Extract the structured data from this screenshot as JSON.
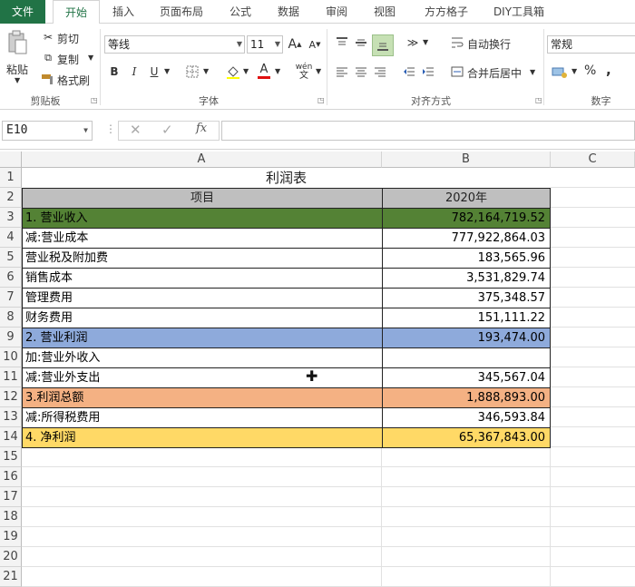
{
  "ribbon": {
    "tabs": [
      "文件",
      "开始",
      "插入",
      "页面布局",
      "公式",
      "数据",
      "审阅",
      "视图",
      "方方格子",
      "DIY工具箱"
    ],
    "active_tab": "开始",
    "clipboard": {
      "paste": "粘贴",
      "cut": "剪切",
      "copy": "复制",
      "format_painter": "格式刷",
      "group": "剪贴板"
    },
    "font": {
      "name": "等线",
      "size": "11",
      "group": "字体"
    },
    "alignment": {
      "wrap": "自动换行",
      "merge": "合并后居中",
      "group": "对齐方式"
    },
    "number": {
      "format": "常规",
      "percent": "%",
      "comma": ",",
      "group": "数字"
    }
  },
  "formula_bar": {
    "name_box": "E10",
    "fx": "fx",
    "value": ""
  },
  "grid": {
    "columns": [
      "A",
      "B",
      "C"
    ],
    "row_numbers": [
      "1",
      "2",
      "3",
      "4",
      "5",
      "6",
      "7",
      "8",
      "9",
      "10",
      "11",
      "12",
      "13",
      "14",
      "15",
      "16",
      "17",
      "18",
      "19",
      "20",
      "21"
    ],
    "title": "利润表",
    "header": {
      "item": "项目",
      "year": "2020年"
    },
    "rows": [
      {
        "label": "1. 营业收入",
        "value": "782,164,719.52",
        "fill": "#548235",
        "text": "#000000"
      },
      {
        "label": "减:营业成本",
        "value": "777,922,864.03",
        "fill": "#ffffff",
        "text": "#000000"
      },
      {
        "label": "营业税及附加费",
        "value": "183,565.96",
        "fill": "#ffffff",
        "text": "#000000"
      },
      {
        "label": "销售成本",
        "value": "3,531,829.74",
        "fill": "#ffffff",
        "text": "#000000"
      },
      {
        "label": "管理费用",
        "value": "375,348.57",
        "fill": "#ffffff",
        "text": "#000000"
      },
      {
        "label": "财务费用",
        "value": "151,111.22",
        "fill": "#ffffff",
        "text": "#000000"
      },
      {
        "label": "2. 营业利润",
        "value": "193,474.00",
        "fill": "#8eaadb",
        "text": "#000000"
      },
      {
        "label": "加:营业外收入",
        "value": "",
        "fill": "#ffffff",
        "text": "#000000"
      },
      {
        "label": "减:营业外支出",
        "value": "345,567.04",
        "fill": "#ffffff",
        "text": "#000000"
      },
      {
        "label": "3.利润总额",
        "value": "1,888,893.00",
        "fill": "#f4b183",
        "text": "#000000"
      },
      {
        "label": "减:所得税费用",
        "value": "346,593.84",
        "fill": "#ffffff",
        "text": "#000000"
      },
      {
        "label": "4. 净利润",
        "value": "65,367,843.00",
        "fill": "#ffd966",
        "text": "#000000"
      }
    ],
    "header_fill": "#bfbfbf"
  }
}
